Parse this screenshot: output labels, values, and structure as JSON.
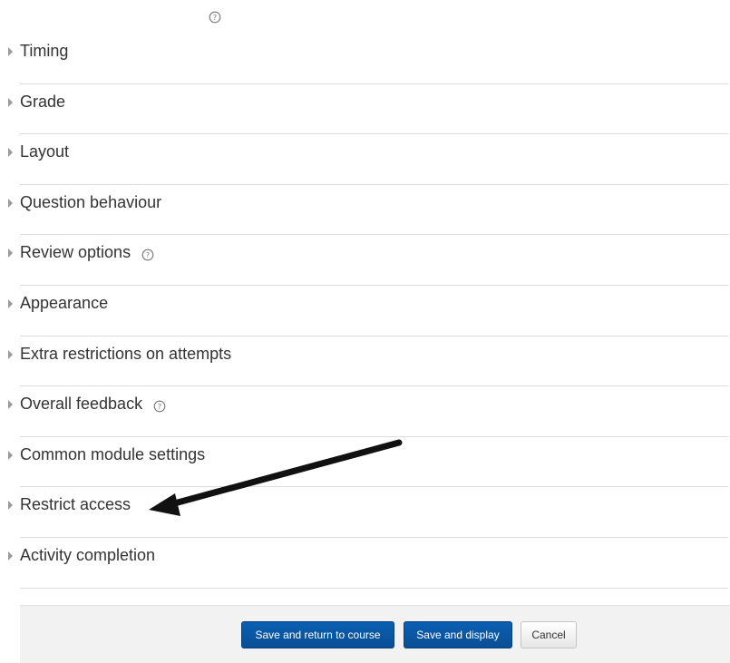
{
  "sections": [
    {
      "label": "Timing",
      "help": false
    },
    {
      "label": "Grade",
      "help": false
    },
    {
      "label": "Layout",
      "help": false
    },
    {
      "label": "Question behaviour",
      "help": false
    },
    {
      "label": "Review options",
      "help": true
    },
    {
      "label": "Appearance",
      "help": false
    },
    {
      "label": "Extra restrictions on attempts",
      "help": false
    },
    {
      "label": "Overall feedback",
      "help": true
    },
    {
      "label": "Common module settings",
      "help": false
    },
    {
      "label": "Restrict access",
      "help": false
    },
    {
      "label": "Activity completion",
      "help": false
    }
  ],
  "buttons": {
    "save_return": "Save and return to course",
    "save_display": "Save and display",
    "cancel": "Cancel"
  },
  "colors": {
    "primary": "#0a5bac",
    "divider": "#dcdcdc",
    "footer_bg": "#f2f2f2",
    "arrow": "#111111"
  },
  "icons": {
    "help": "help-question-icon",
    "expand": "expand-triangle-icon",
    "annotation": "pointer-arrow-icon"
  }
}
